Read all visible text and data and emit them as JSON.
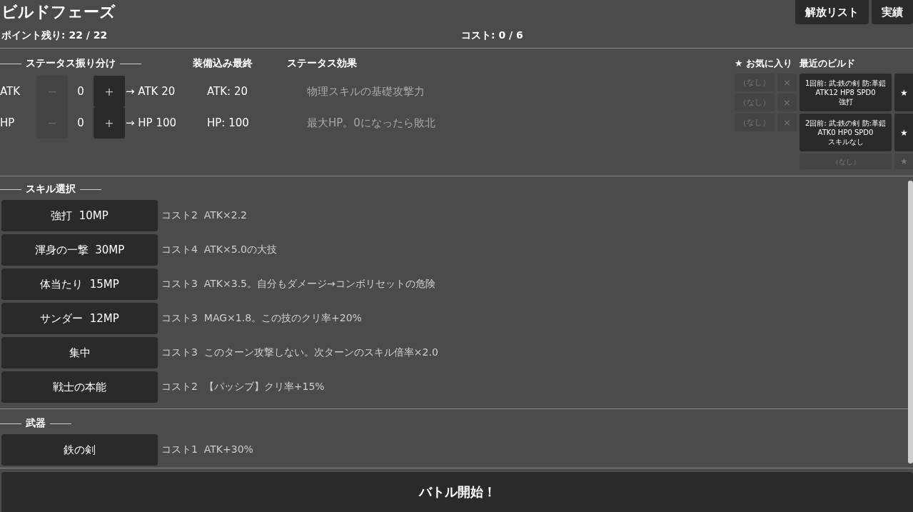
{
  "header": {
    "title": "ビルドフェーズ",
    "points": "ポイント残り: 22 / 22",
    "cost": "コスト: 0 / 6",
    "buttons": [
      "解放リスト",
      "実績"
    ]
  },
  "stats": {
    "heading": "ステータス振り分け",
    "final_heading": "装備込み最終",
    "effect_heading": "ステータス効果",
    "rows": [
      {
        "label": "ATK",
        "minus": "−",
        "minus_disabled": true,
        "value": "0",
        "plus": "+",
        "plus_disabled": false,
        "preview": "→ ATK 20",
        "final": "ATK: 20",
        "effect": "物理スキルの基礎攻撃力"
      },
      {
        "label": "HP",
        "minus": "−",
        "minus_disabled": true,
        "value": "0",
        "plus": "+",
        "plus_disabled": false,
        "preview": "→ HP 100",
        "final": "HP: 100",
        "effect": "最大HP。0になったら敗北"
      }
    ]
  },
  "favorites": {
    "heading": "★ お気に入り",
    "items": [
      {
        "label": "（なし）",
        "remove": "×",
        "disabled": true
      },
      {
        "label": "（なし）",
        "remove": "×",
        "disabled": true
      },
      {
        "label": "（なし）",
        "remove": "×",
        "disabled": true
      }
    ]
  },
  "recent": {
    "heading": "最近のビルド",
    "items": [
      {
        "lines": [
          "1回前: 武:鉄の剣 防:革鎧",
          "ATK12 HP8 SPD0",
          "強打"
        ],
        "star": "★",
        "disabled": false
      },
      {
        "lines": [
          "2回前: 武:鉄の剣 防:革鎧",
          "ATK0 HP0 SPD0",
          "スキルなし"
        ],
        "star": "★",
        "disabled": false
      },
      {
        "lines": [
          "（なし）"
        ],
        "star": "★",
        "disabled": true
      }
    ]
  },
  "sections": [
    {
      "heading": "スキル選択",
      "items": [
        {
          "name": "強打  10MP",
          "desc": "コスト2  ATK×2.2"
        },
        {
          "name": "渾身の一撃  30MP",
          "desc": "コスト4  ATK×5.0の大技"
        },
        {
          "name": "体当たり  15MP",
          "desc": "コスト3  ATK×3.5。自分もダメージ→コンボリセットの危険"
        },
        {
          "name": "サンダー  12MP",
          "desc": "コスト3  MAG×1.8。この技のクリ率+20%"
        },
        {
          "name": "集中",
          "desc": "コスト3  このターン攻撃しない。次ターンのスキル倍率×2.0"
        },
        {
          "name": "戦士の本能",
          "desc": "コスト2  【パッシブ】クリ率+15%"
        }
      ]
    },
    {
      "heading": "武器",
      "items": [
        {
          "name": "鉄の剣",
          "desc": "コスト1  ATK+30%"
        }
      ]
    }
  ],
  "start_button": "バトル開始！"
}
